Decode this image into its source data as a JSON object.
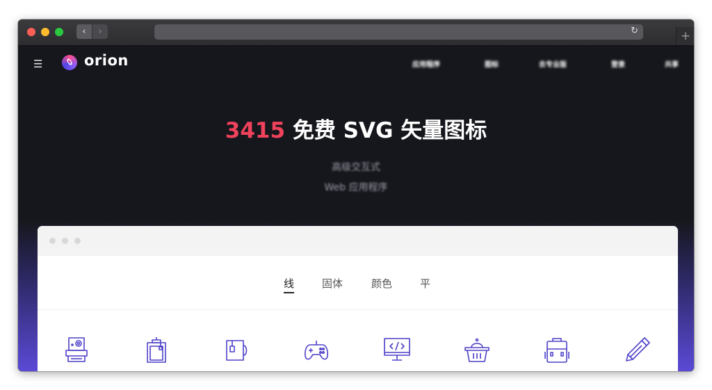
{
  "browser": {
    "back_glyph": "‹",
    "forward_glyph": "›",
    "reload_glyph": "↻",
    "new_tab_glyph": "+"
  },
  "header": {
    "menu_glyph": "☰",
    "logo_text": "orion",
    "nav": [
      "应用程序",
      "图标",
      "去专业版",
      "登录",
      "共享"
    ]
  },
  "hero": {
    "count": "3415",
    "title_rest": " 免费 SVG 矢量图标",
    "subtitle_line1": "高级交互式",
    "subtitle_line2": "Web 应用程序"
  },
  "tabs": [
    "线",
    "固体",
    "颜色",
    "平"
  ],
  "active_tab": "线",
  "icons": [
    "printer-icon",
    "tea-bag-icon",
    "tea-mug-icon",
    "gamepad-icon",
    "code-monitor-icon",
    "shopping-basket-icon",
    "backpack-icon",
    "pencil-icon"
  ],
  "colors": {
    "accent": "#f0425c",
    "icon_stroke": "#4b3fc9",
    "gradient_bottom": "#5a4ad6"
  }
}
